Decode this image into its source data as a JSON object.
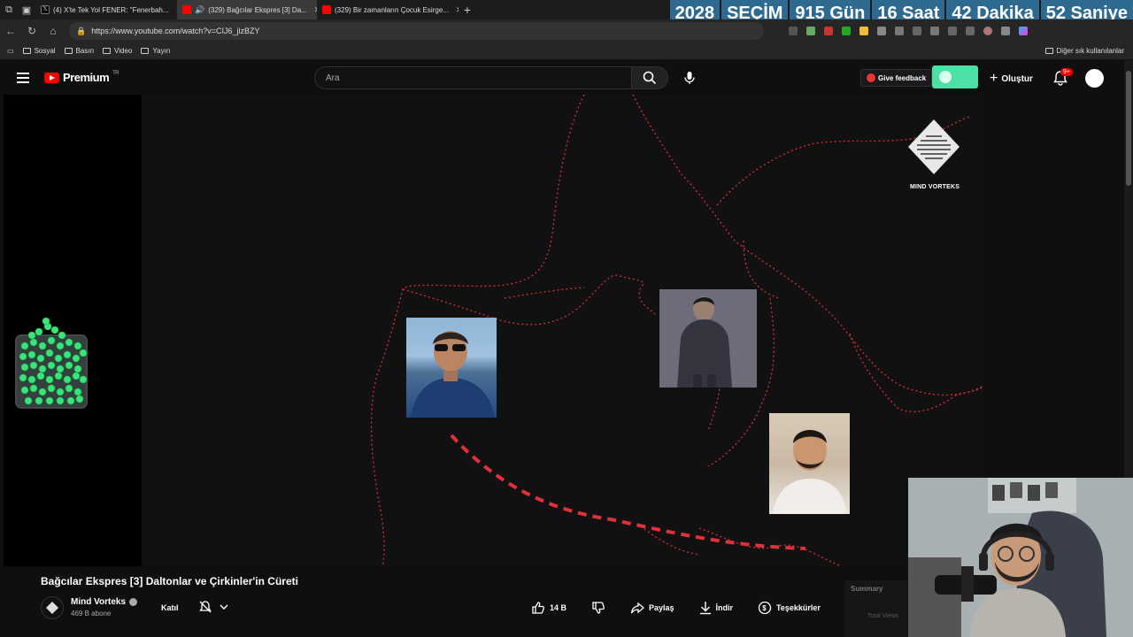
{
  "browser": {
    "tabs": [
      {
        "title": "(4) X'te Tek Yol FENER: \"Fenerbah...",
        "favicon_color": "#ffffff",
        "active": false
      },
      {
        "title": "(329) Bağcılar Ekspres [3] Da...",
        "favicon_color": "#ff0000",
        "active": true
      },
      {
        "title": "(329) Bir zamanların Çocuk Esirge...",
        "favicon_color": "#ff0000",
        "active": false
      }
    ],
    "new_tab": "+",
    "url": "https://www.youtube.com/watch?v=CIJ6_jlzBZY",
    "bookmarks": [
      "Sosyal",
      "Basın",
      "Video",
      "Yayın"
    ],
    "bookmarks_other": "Diğer sık kullanılanlar"
  },
  "countdown": {
    "year": "2028",
    "label": "SEÇİM",
    "days": "915 Gün",
    "hours": "16 Saat",
    "minutes": "42 Dakika",
    "seconds": "52 Saniye"
  },
  "youtube": {
    "logo_text": "Premium",
    "region": "TR",
    "search_placeholder": "Ara",
    "feedback_label": "Give feedback",
    "create_label": "Oluştur",
    "notif_badge": "9+",
    "video_overlay_brand": "MIND VORTEKS",
    "video": {
      "title": "Bağcılar Ekspres [3] Daltonlar ve Çirkinler'in Cüreti",
      "channel": "Mind Vorteks",
      "subscribers": "469 B abone",
      "join_label": "Katıl",
      "likes": "14 B",
      "share_label": "Paylaş",
      "download_label": "İndir",
      "thanks_label": "Teşekkürler",
      "more_label": "⋯"
    },
    "summary": {
      "title": "Summary",
      "sub": "Total Views"
    }
  },
  "colors": {
    "accent_red": "#ff0000",
    "map_line": "#e0303a",
    "countdown_bg": "#2e6a90",
    "pill_green": "#4de0a5"
  }
}
